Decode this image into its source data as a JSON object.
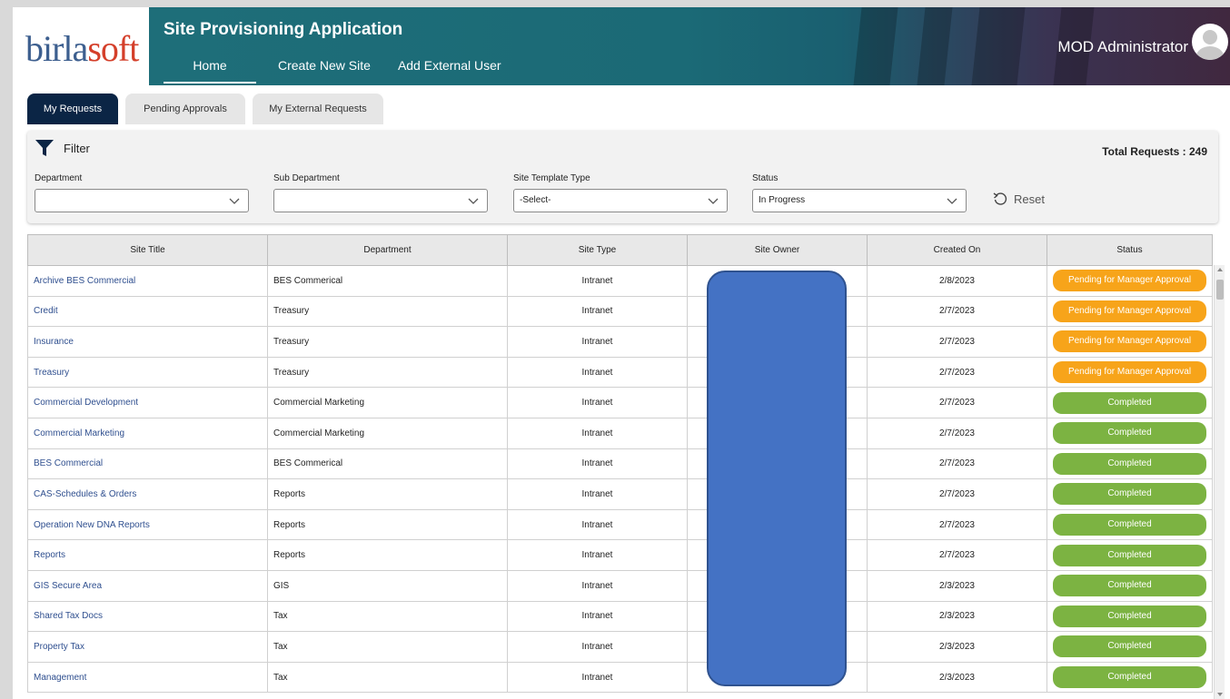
{
  "header": {
    "logo_part1": "birla",
    "logo_part2": "soft",
    "app_title": "Site Provisioning Application",
    "nav": [
      "Home",
      "Create New Site",
      "Add External User"
    ],
    "user_name": "MOD Administrator"
  },
  "tabs": [
    "My Requests",
    "Pending Approvals",
    "My External Requests"
  ],
  "filter": {
    "label": "Filter",
    "total_label": "Total Requests : 249",
    "fields": [
      {
        "label": "Department",
        "value": ""
      },
      {
        "label": "Sub Department",
        "value": ""
      },
      {
        "label": "Site Template Type",
        "value": "-Select-"
      },
      {
        "label": "Status",
        "value": "In Progress"
      }
    ],
    "reset_label": "Reset"
  },
  "table": {
    "columns": [
      "Site Title",
      "Department",
      "Site Type",
      "Site Owner",
      "Created On",
      "Status"
    ],
    "rows": [
      {
        "title": "Archive BES Commercial",
        "department": "BES Commerical",
        "type": "Intranet",
        "owner": "",
        "created": "2/8/2023",
        "status": "Pending for Manager Approval"
      },
      {
        "title": "Credit",
        "department": "Treasury",
        "type": "Intranet",
        "owner": "",
        "created": "2/7/2023",
        "status": "Pending for Manager Approval"
      },
      {
        "title": "Insurance",
        "department": "Treasury",
        "type": "Intranet",
        "owner": "",
        "created": "2/7/2023",
        "status": "Pending for Manager Approval"
      },
      {
        "title": "Treasury",
        "department": "Treasury",
        "type": "Intranet",
        "owner": "",
        "created": "2/7/2023",
        "status": "Pending for Manager Approval"
      },
      {
        "title": "Commercial Development",
        "department": "Commercial Marketing",
        "type": "Intranet",
        "owner": "",
        "created": "2/7/2023",
        "status": "Completed"
      },
      {
        "title": "Commercial Marketing",
        "department": "Commercial Marketing",
        "type": "Intranet",
        "owner": "",
        "created": "2/7/2023",
        "status": "Completed"
      },
      {
        "title": "BES Commercial",
        "department": "BES Commerical",
        "type": "Intranet",
        "owner": "",
        "created": "2/7/2023",
        "status": "Completed"
      },
      {
        "title": "CAS-Schedules & Orders",
        "department": "Reports",
        "type": "Intranet",
        "owner": "",
        "created": "2/7/2023",
        "status": "Completed"
      },
      {
        "title": "Operation New DNA Reports",
        "department": "Reports",
        "type": "Intranet",
        "owner": "",
        "created": "2/7/2023",
        "status": "Completed"
      },
      {
        "title": "Reports",
        "department": "Reports",
        "type": "Intranet",
        "owner": "",
        "created": "2/7/2023",
        "status": "Completed"
      },
      {
        "title": "GIS Secure Area",
        "department": "GIS",
        "type": "Intranet",
        "owner": "",
        "created": "2/3/2023",
        "status": "Completed"
      },
      {
        "title": "Shared Tax Docs",
        "department": "Tax",
        "type": "Intranet",
        "owner": "",
        "created": "2/3/2023",
        "status": "Completed"
      },
      {
        "title": "Property Tax",
        "department": "Tax",
        "type": "Intranet",
        "owner": "",
        "created": "2/3/2023",
        "status": "Completed"
      },
      {
        "title": "Management",
        "department": "Tax",
        "type": "Intranet",
        "owner": "",
        "created": "2/3/2023",
        "status": "Completed"
      }
    ]
  },
  "colors": {
    "header_teal": "#1f6f7a",
    "tab_active": "#0b2545",
    "pending": "#f7a41a",
    "completed": "#7cb342",
    "link": "#2f4f8f",
    "redaction": "#4472c4"
  }
}
